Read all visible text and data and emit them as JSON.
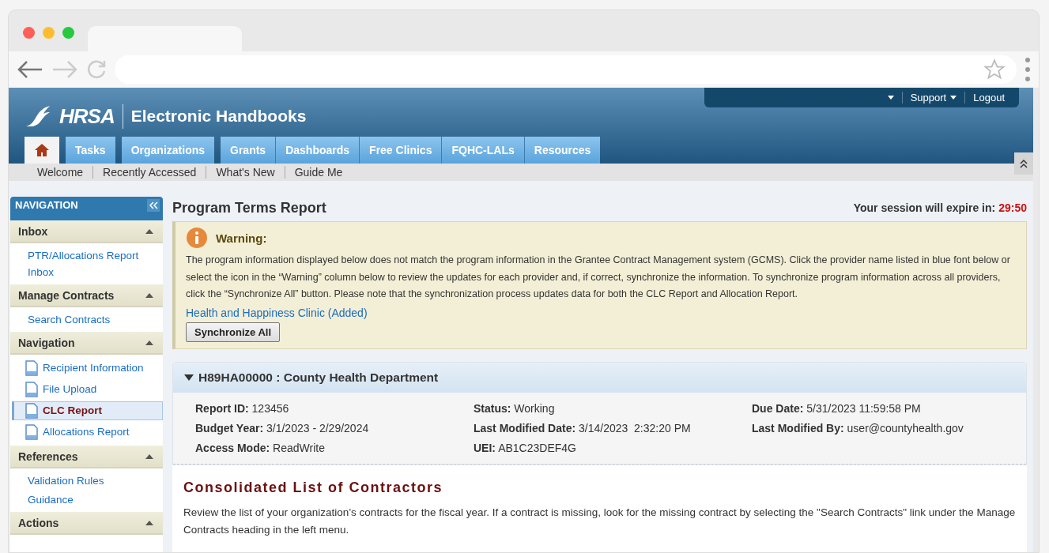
{
  "header": {
    "logo_text": "HRSA",
    "title": "Electronic Handbooks",
    "user_menu": [
      {
        "kind": "caret"
      },
      {
        "kind": "dropdown",
        "label": "Support"
      },
      {
        "kind": "link",
        "label": "Logout"
      }
    ]
  },
  "tabs": [
    {
      "kind": "home",
      "selected": true
    },
    {
      "kind": "tab",
      "label": "Tasks",
      "selected": false,
      "group_end": true
    },
    {
      "kind": "tab",
      "label": "Organizations",
      "selected": false,
      "group_end": true
    },
    {
      "kind": "tab",
      "label": "Grants",
      "selected": false,
      "group_end": false
    },
    {
      "kind": "tab",
      "label": "Dashboards",
      "selected": false,
      "group_end": false
    },
    {
      "kind": "tab",
      "label": "Free Clinics",
      "selected": false,
      "group_end": false
    },
    {
      "kind": "tab",
      "label": "FQHC-LALs",
      "selected": false,
      "group_end": false
    },
    {
      "kind": "tab",
      "label": "Resources",
      "selected": false,
      "group_end": true
    }
  ],
  "subnav": [
    "Welcome",
    "Recently Accessed",
    "What's New",
    "Guide Me"
  ],
  "sidebar": {
    "title": "NAVIGATION",
    "sections": [
      {
        "title": "Inbox",
        "expanded": true,
        "items": [
          {
            "kind": "link",
            "label": "PTR/Allocations Report Inbox",
            "selected": false
          }
        ]
      },
      {
        "title": "Manage Contracts",
        "expanded": true,
        "items": [
          {
            "kind": "link",
            "label": "Search Contracts",
            "selected": false
          }
        ]
      },
      {
        "title": "Navigation",
        "expanded": true,
        "items": [
          {
            "kind": "page",
            "label": "Recipient Information",
            "selected": false
          },
          {
            "kind": "page",
            "label": "File Upload",
            "selected": false
          },
          {
            "kind": "page",
            "label": "CLC Report",
            "selected": true
          },
          {
            "kind": "page",
            "label": "Allocations Report",
            "selected": false
          }
        ]
      },
      {
        "title": "References",
        "expanded": true,
        "items": [
          {
            "kind": "link",
            "label": "Validation Rules",
            "selected": false
          },
          {
            "kind": "link",
            "label": "Guidance",
            "selected": false
          }
        ]
      },
      {
        "title": "Actions",
        "expanded": true
      }
    ]
  },
  "main": {
    "title": "Program Terms Report",
    "session": {
      "label": "Your session will expire in:",
      "time": "29:50"
    },
    "warning": {
      "title": "Warning:",
      "text": "The program information displayed below does not match the program information in the Grantee Contract Management system (GCMS). Click the provider name listed in blue font below or select the icon in the “Warning” column below to review the updates for each provider and, if correct, synchronize the information. To synchronize program information across all providers, click the “Synchronize All” button. Please note that the synchronization process updates data for both the CLC Report and Allocation Report.",
      "links": [
        "Health and Happiness Clinic (Added)"
      ],
      "button": "Synchronize All"
    },
    "report": {
      "title": "H89HA00000 : County Health Department",
      "expanded": true,
      "fields": [
        {
          "label": "Report ID:",
          "value": "123456"
        },
        {
          "label": "Status:",
          "value": "Working"
        },
        {
          "label": "Due Date:",
          "value": "5/31/2023 11:59:58 PM"
        },
        {
          "label": "Budget Year:",
          "value": "3/1/2023 - 2/29/2024"
        },
        {
          "label": "Last Modified Date:",
          "value": "3/14/2023  2:32:20 PM"
        },
        {
          "label": "Last Modified By:",
          "value": "user@countyhealth.gov"
        },
        {
          "label": "Access Mode:",
          "value": "ReadWrite"
        },
        {
          "label": "UEI:",
          "value": "AB1C23DEF4G"
        }
      ]
    },
    "section": {
      "title": "Consolidated List of Contractors",
      "text": "Review the list of your organization’s contracts for the fiscal year. If a contract is missing, look for the missing contract by selecting the \"Search Contracts\" link under the Manage Contracts heading in the left menu."
    }
  }
}
